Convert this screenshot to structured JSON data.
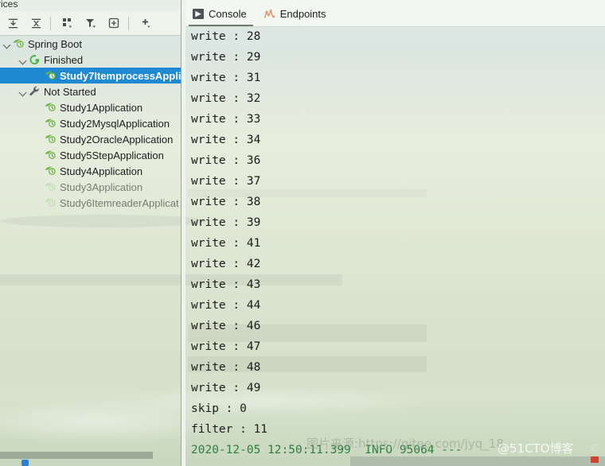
{
  "window": {
    "tool_window_tab": "rices"
  },
  "toolbar": {
    "buttons": [
      {
        "name": "expand-all-button",
        "title": "Expand All"
      },
      {
        "name": "collapse-all-button",
        "title": "Collapse All"
      },
      {
        "name": "group-by-button",
        "title": "Group By"
      },
      {
        "name": "filter-button",
        "title": "Filter"
      },
      {
        "name": "add-tab-button",
        "title": "Show in New Tab"
      },
      {
        "name": "add-service-button",
        "title": "Add Service"
      }
    ]
  },
  "services_tree": [
    {
      "label": "Spring Boot",
      "icon": "spring-boot-icon",
      "depth": 0,
      "expanded": true,
      "selected": false,
      "dim": false
    },
    {
      "label": "Finished",
      "icon": "finished-icon",
      "depth": 1,
      "expanded": true,
      "selected": false,
      "dim": false
    },
    {
      "label": "Study7ItemprocessAppli",
      "icon": "spring-boot-icon",
      "depth": 2,
      "expanded": false,
      "selected": true,
      "dim": false
    },
    {
      "label": "Not Started",
      "icon": "wrench-icon",
      "depth": 1,
      "expanded": true,
      "selected": false,
      "dim": false
    },
    {
      "label": "Study1Application",
      "icon": "spring-boot-icon",
      "depth": 2,
      "expanded": false,
      "selected": false,
      "dim": false
    },
    {
      "label": "Study2MysqlApplication",
      "icon": "spring-boot-icon",
      "depth": 2,
      "expanded": false,
      "selected": false,
      "dim": false
    },
    {
      "label": "Study2OracleApplication",
      "icon": "spring-boot-icon",
      "depth": 2,
      "expanded": false,
      "selected": false,
      "dim": false
    },
    {
      "label": "Study5StepApplication",
      "icon": "spring-boot-icon",
      "depth": 2,
      "expanded": false,
      "selected": false,
      "dim": false
    },
    {
      "label": "Study4Application",
      "icon": "spring-boot-icon",
      "depth": 2,
      "expanded": false,
      "selected": false,
      "dim": false
    },
    {
      "label": "Study3Application",
      "icon": "spring-boot-icon",
      "depth": 2,
      "expanded": false,
      "selected": false,
      "dim": true
    },
    {
      "label": "Study6ItemreaderApplicat",
      "icon": "spring-boot-icon",
      "depth": 2,
      "expanded": false,
      "selected": false,
      "dim": true
    }
  ],
  "tabs": [
    {
      "label": "Console",
      "icon": "console-icon",
      "active": true
    },
    {
      "label": "Endpoints",
      "icon": "endpoints-icon",
      "active": false
    }
  ],
  "console_lines": [
    {
      "text": "write : 28",
      "color": "default"
    },
    {
      "text": "write : 29",
      "color": "default"
    },
    {
      "text": "write : 31",
      "color": "default"
    },
    {
      "text": "write : 32",
      "color": "default"
    },
    {
      "text": "write : 33",
      "color": "default"
    },
    {
      "text": "write : 34",
      "color": "default"
    },
    {
      "text": "write : 36",
      "color": "default"
    },
    {
      "text": "write : 37",
      "color": "default"
    },
    {
      "text": "write : 38",
      "color": "default"
    },
    {
      "text": "write : 39",
      "color": "default"
    },
    {
      "text": "write : 41",
      "color": "default"
    },
    {
      "text": "write : 42",
      "color": "default"
    },
    {
      "text": "write : 43",
      "color": "default"
    },
    {
      "text": "write : 44",
      "color": "default"
    },
    {
      "text": "write : 46",
      "color": "default"
    },
    {
      "text": "write : 47",
      "color": "default"
    },
    {
      "text": "write : 48",
      "color": "default"
    },
    {
      "text": "write : 49",
      "color": "default"
    },
    {
      "text": "skip : 0",
      "color": "default"
    },
    {
      "text": "filter : 11",
      "color": "default"
    },
    {
      "text": "2020-12-05 12:50:11.399  INFO 95064 ---",
      "color": "green"
    }
  ],
  "watermarks": {
    "source": "图片来源:https://gitee.com/jyq_18",
    "site": "@51CTO博客",
    "copyright": "©"
  },
  "colors": {
    "selection": "#1f8ad1",
    "console_text": "#1b1b1b",
    "log_info_green": "#2f7d3f",
    "spring_green": "#6cb33f",
    "endpoints_orange": "#e8916b"
  }
}
